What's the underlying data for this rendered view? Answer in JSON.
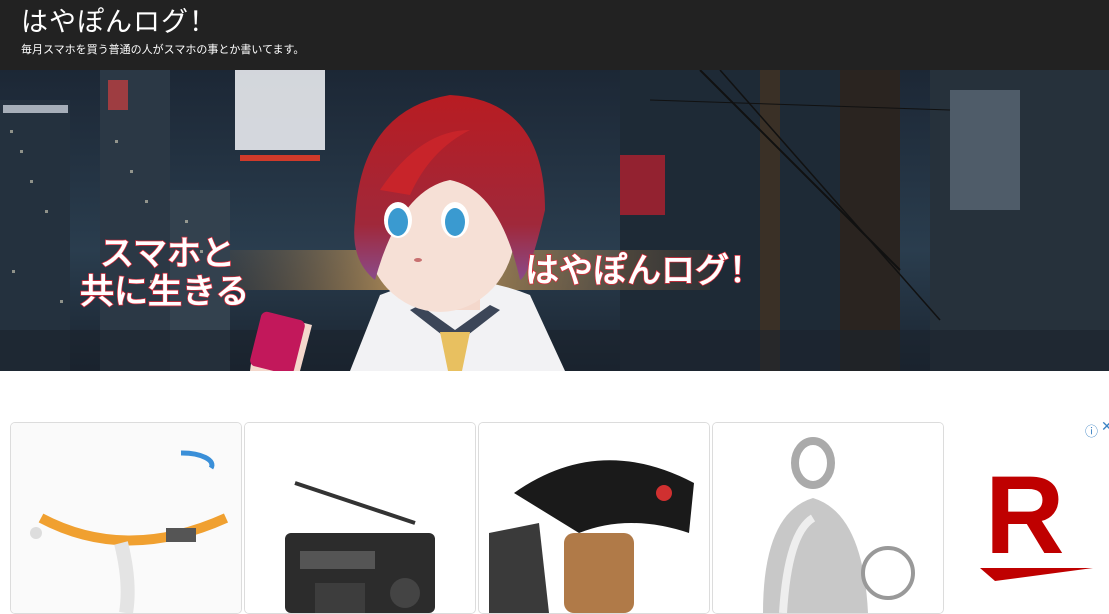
{
  "header": {
    "title": "はやぽんログ！",
    "tagline": "毎月スマホを買う普通の人がスマホの事とか書いてます。"
  },
  "banner": {
    "left_text_line1": "スマホと",
    "left_text_line2": "共に生きる",
    "right_text": "はやぽんログ！"
  },
  "ads": {
    "info_icon": "info-icon",
    "close_icon": "close-icon",
    "brand_logo_text": "R",
    "brand_color": "#bf0000",
    "products": [
      {
        "icon": "harness-strap-icon"
      },
      {
        "icon": "radio-icon"
      },
      {
        "icon": "camera-grip-icon"
      },
      {
        "icon": "bell-pendant-icon"
      }
    ]
  }
}
